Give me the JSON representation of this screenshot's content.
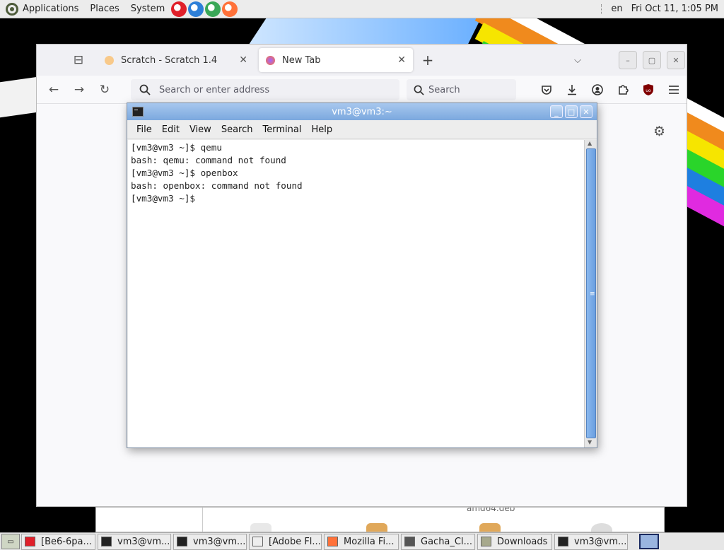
{
  "top_panel": {
    "menus": [
      "Applications",
      "Places",
      "System"
    ],
    "keyboard_layout": "en",
    "clock": "Fri Oct 11,  1:05 PM",
    "launchers": [
      {
        "name": "opera-launcher-icon",
        "color": "#e0202a"
      },
      {
        "name": "edge-dev-launcher-icon",
        "color": "#2d7fd8",
        "badge": "DEV"
      },
      {
        "name": "chrome-launcher-icon",
        "color": "#3aa757",
        "badge": "D"
      },
      {
        "name": "firefox-launcher-icon",
        "color": "#ff7139"
      }
    ]
  },
  "firefox": {
    "tabs": [
      {
        "title": "Scratch - Scratch 1.4",
        "active": false,
        "close": "✕"
      },
      {
        "title": "New Tab",
        "active": true,
        "close": "✕"
      }
    ],
    "new_tab_symbol": "+",
    "list_all_tabs_symbol": "⌵",
    "window_buttons": {
      "minimize": "–",
      "maximize": "▢",
      "close": "✕"
    },
    "nav": {
      "back": "←",
      "forward": "→",
      "reload": "↻"
    },
    "urlbar": {
      "placeholder": "Search or enter address"
    },
    "searchbar": {
      "placeholder": "Search"
    },
    "toolbar_icons": [
      "pocket-icon",
      "downloads-icon",
      "account-icon",
      "extensions-icon",
      "ublock-icon",
      "menu-icon"
    ]
  },
  "file_manager_bg": {
    "visible_text": "amd64.deb"
  },
  "terminal": {
    "title": "vm3@vm3:~",
    "menus": [
      "File",
      "Edit",
      "View",
      "Search",
      "Terminal",
      "Help"
    ],
    "lines": [
      "[vm3@vm3 ~]$ qemu",
      "bash: qemu: command not found",
      "[vm3@vm3 ~]$ openbox",
      "bash: openbox: command not found",
      "[vm3@vm3 ~]$ "
    ],
    "buttons": {
      "minimize": "_",
      "maximize": "□",
      "close": "✕"
    }
  },
  "taskbar": {
    "show_desktop": "▭",
    "tasks": [
      {
        "label": "[Be6-6pa...",
        "icon_color": "#e0202a",
        "width": 105
      },
      {
        "label": "vm3@vm...",
        "icon_color": "#222",
        "width": 104
      },
      {
        "label": "vm3@vm...",
        "icon_color": "#222",
        "width": 104
      },
      {
        "label": "[Adobe Fl...",
        "icon_color": "#eee",
        "width": 103
      },
      {
        "label": "Mozilla Fi...",
        "icon_color": "#ff7139",
        "width": 106
      },
      {
        "label": "Gacha_Cl...",
        "icon_color": "#555",
        "width": 105
      },
      {
        "label": "Downloads",
        "icon_color": "#a7a98d",
        "width": 106
      },
      {
        "label": "vm3@vm...",
        "icon_color": "#222",
        "width": 104
      }
    ]
  }
}
